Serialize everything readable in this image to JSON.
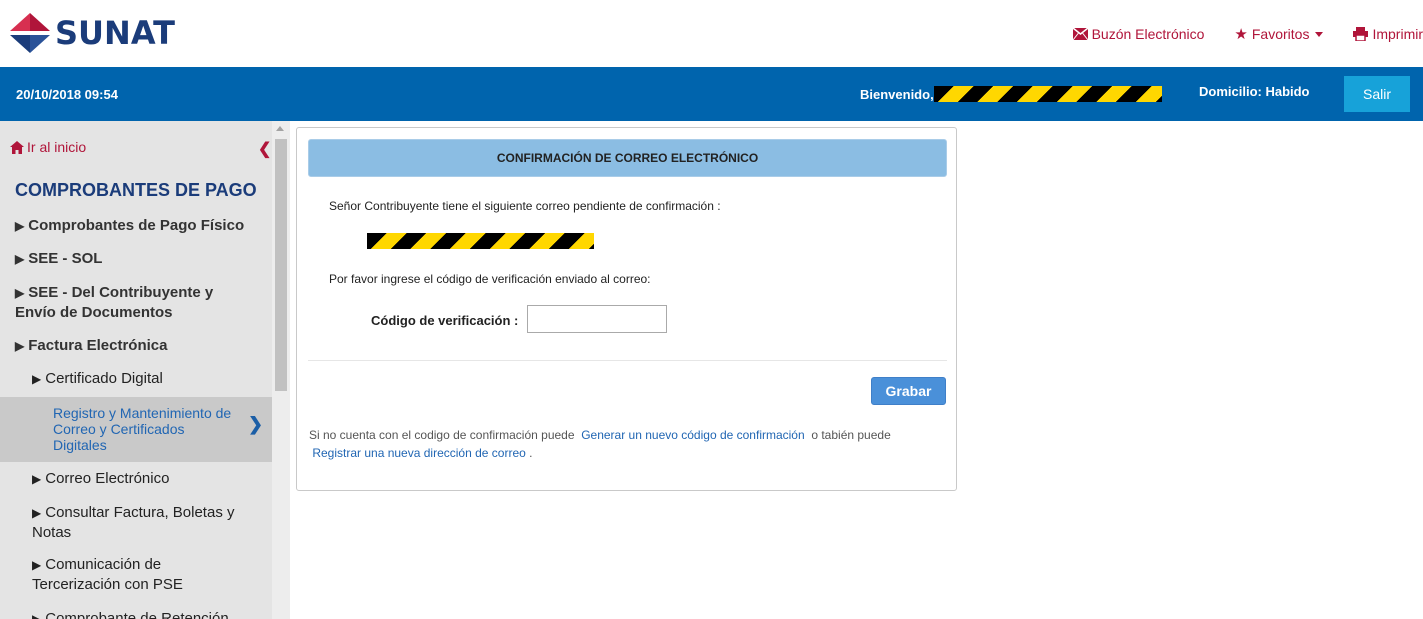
{
  "brand": {
    "name": "SUNAT"
  },
  "top_links": {
    "mailbox": "Buzón Electrónico",
    "favorites": "Favoritos",
    "print": "Imprimir"
  },
  "bar": {
    "datetime": "20/10/2018 09:54",
    "welcome": "Bienvenido,",
    "domicilio": "Domicilio: Habido",
    "logout": "Salir"
  },
  "sidebar": {
    "home": "Ir al inicio",
    "title": "COMPROBANTES DE PAGO",
    "items": [
      "Comprobantes de Pago Físico",
      "SEE - SOL",
      "SEE - Del Contribuyente y Envío de Documentos",
      "Factura Electrónica"
    ],
    "subitems": [
      "Certificado Digital",
      "Registro y Mantenimiento de Correo y Certificados Digitales",
      "Correo Electrónico",
      "Consultar Factura, Boletas y Notas",
      "Comunicación de Tercerización con PSE",
      "Comprobante de Retención"
    ]
  },
  "panel": {
    "title": "CONFIRMACIÓN DE CORREO ELECTRÓNICO",
    "message": "Señor Contribuyente tiene el siguiente correo pendiente de confirmación :",
    "instruction": "Por favor ingrese el código de verificación enviado al correo:",
    "code_label": "Código de verificación :",
    "code_value": "",
    "save_button": "Grabar",
    "footer_text1": "Si no cuenta con el codigo de confirmación puede",
    "footer_link1": "Generar un nuevo código de confirmación",
    "footer_text2": "o tabién puede",
    "footer_link2": "Registrar una nueva dirección de correo",
    "footer_end": "."
  },
  "colors": {
    "brand_blue": "#0064ad",
    "brand_red": "#b0153a",
    "header_panel": "#8bbde3",
    "button": "#4a90d9"
  }
}
